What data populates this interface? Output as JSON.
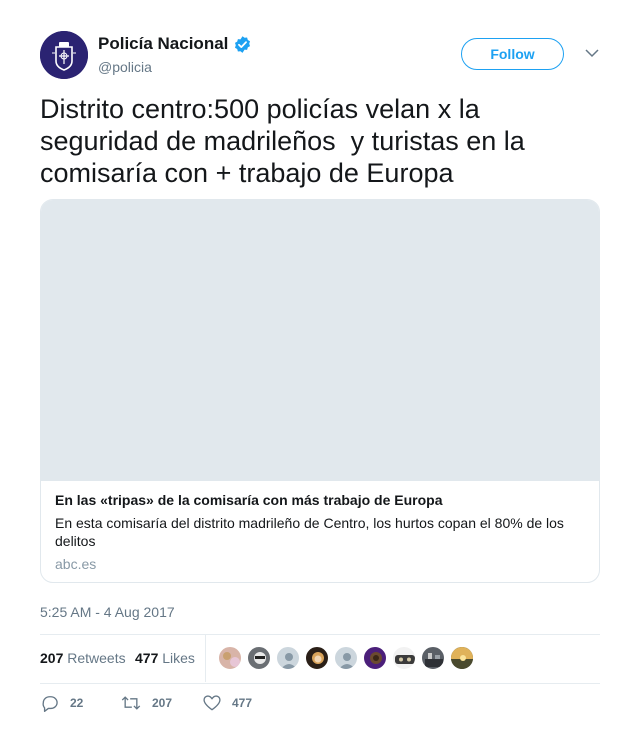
{
  "account": {
    "name": "Policía Nacional",
    "handle": "@policia",
    "follow_label": "Follow"
  },
  "tweet": {
    "text": "Distrito centro:500 policías velan x la seguridad de madrileños  y turistas en la comisaría con + trabajo de Europa",
    "timestamp": "5:25 AM - 4 Aug 2017"
  },
  "card": {
    "title": "En las «tripas» de la comisaría con más trabajo de Europa",
    "description": "En esta comisaría del distrito madrileño de Centro, los hurtos copan el 80% de los delitos",
    "domain": "abc.es"
  },
  "stats": {
    "retweets_count": "207",
    "retweets_label": "Retweets",
    "likes_count": "477",
    "likes_label": "Likes"
  },
  "actions": {
    "reply_count": "22",
    "retweet_count": "207",
    "like_count": "477"
  },
  "colors": {
    "accent": "#1da1f2",
    "muted": "#657786",
    "avatar_bg": "#2b2372"
  }
}
